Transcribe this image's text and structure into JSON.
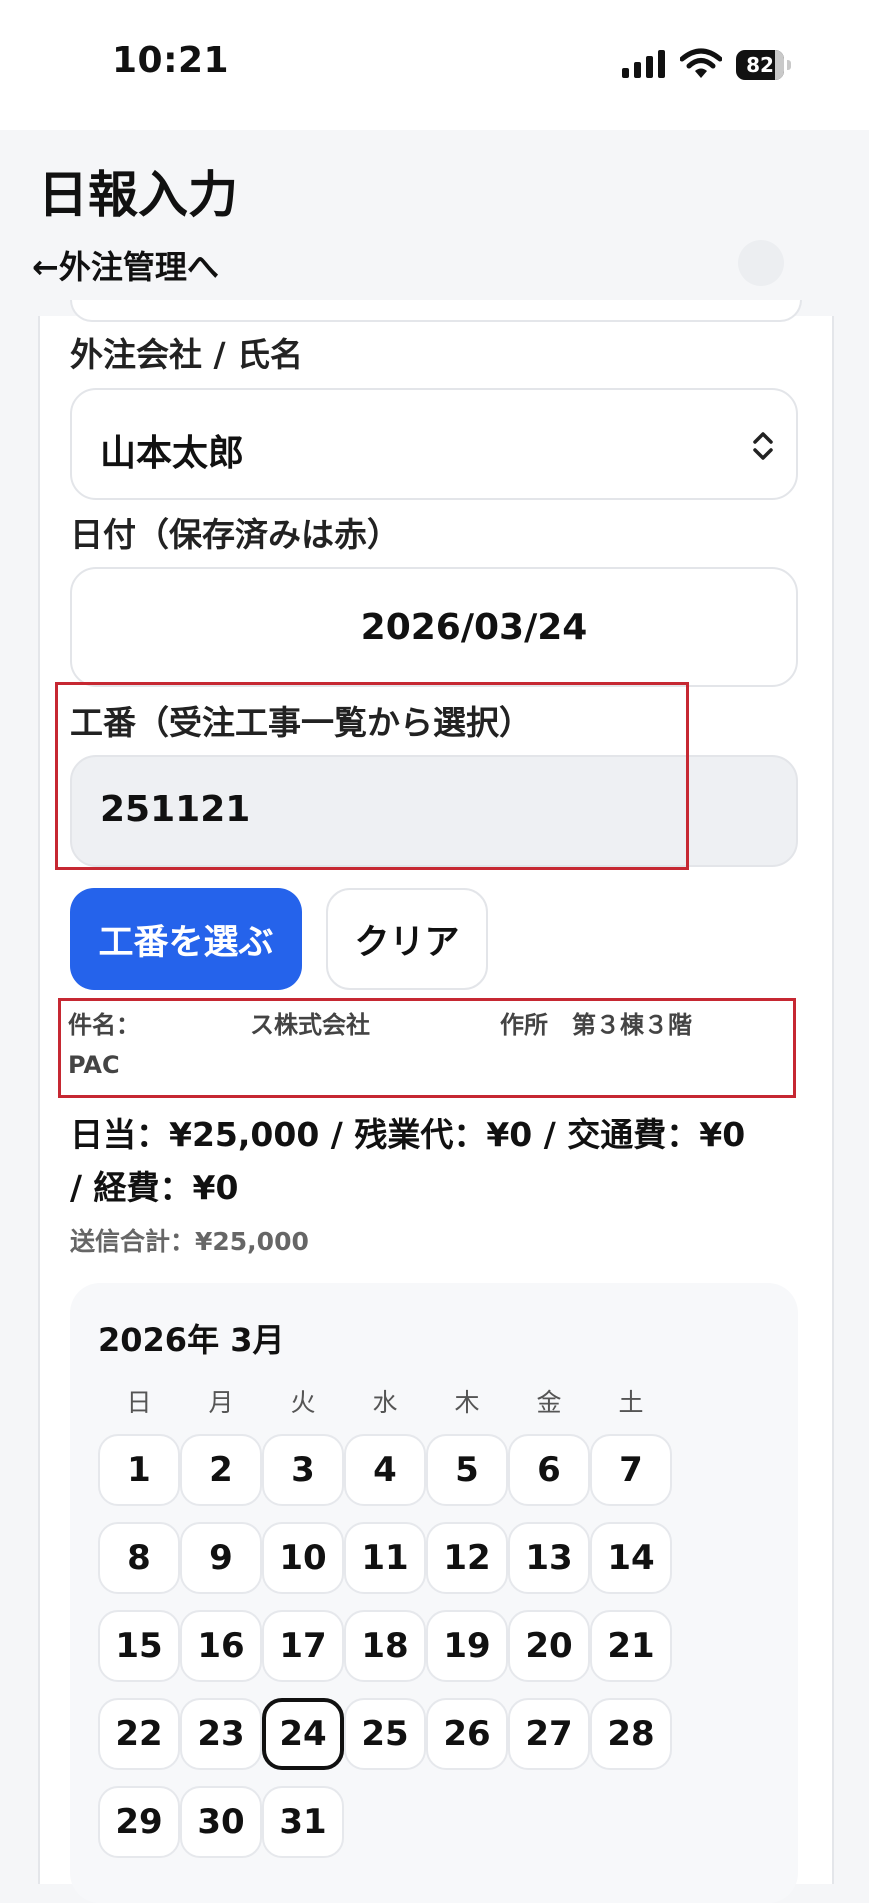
{
  "status": {
    "time": "10:21",
    "battery": "82",
    "battery_level": 0.82
  },
  "header": {
    "title": "日報入力",
    "back_link": "←外注管理へ"
  },
  "form": {
    "contractor_label": "外注会社 / 氏名",
    "contractor_value": "山本太郎",
    "date_label": "日付（保存済みは赤）",
    "date_value": "2026/03/24",
    "kouban_label": "工番（受注工事一覧から選択）",
    "kouban_value": "251121",
    "select_button": "工番を選ぶ",
    "clear_button": "クリア",
    "subject_prefix": "件名：",
    "subject_part1": "ス株式会社",
    "subject_part2": "作所　第３棟３階",
    "subject_line2": "PAC",
    "summary_line1": "日当：¥25,000 / 残業代：¥0 / 交通費：¥0",
    "summary_line2": "/ 経費：¥0",
    "total": "送信合計：¥25,000"
  },
  "calendar": {
    "title": "2026年 3月",
    "weekdays": [
      "日",
      "月",
      "火",
      "水",
      "木",
      "金",
      "土"
    ],
    "days": [
      "1",
      "2",
      "3",
      "4",
      "5",
      "6",
      "7",
      "8",
      "9",
      "10",
      "11",
      "12",
      "13",
      "14",
      "15",
      "16",
      "17",
      "18",
      "19",
      "20",
      "21",
      "22",
      "23",
      "24",
      "25",
      "26",
      "27",
      "28",
      "29",
      "30",
      "31"
    ],
    "selected_day": "24"
  },
  "colors": {
    "primary": "#2563eb",
    "highlight": "#c62832"
  }
}
